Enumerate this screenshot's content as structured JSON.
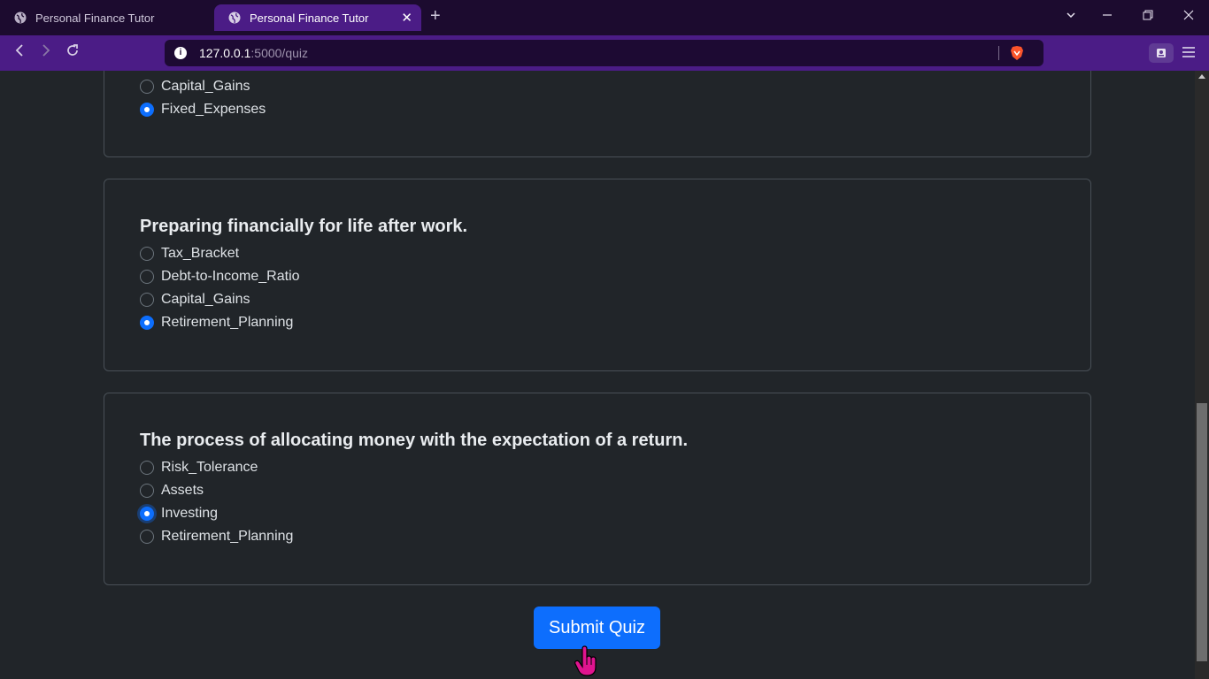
{
  "browser": {
    "tabs": [
      {
        "title": "Personal Finance Tutor",
        "active": false
      },
      {
        "title": "Personal Finance Tutor",
        "active": true
      }
    ],
    "new_tab": "+",
    "url_host": "127.0.0.1",
    "url_path": ":5000/quiz",
    "colors": {
      "titlebar": "#1c0b2f",
      "toolbar": "#4b1c86",
      "urlbar": "#1d0a33"
    }
  },
  "quiz": {
    "cards": [
      {
        "question": "",
        "options": [
          {
            "label": "Capital_Gains",
            "checked": false
          },
          {
            "label": "Fixed_Expenses",
            "checked": true
          }
        ]
      },
      {
        "question": "Preparing financially for life after work.",
        "options": [
          {
            "label": "Tax_Bracket",
            "checked": false
          },
          {
            "label": "Debt-to-Income_Ratio",
            "checked": false
          },
          {
            "label": "Capital_Gains",
            "checked": false
          },
          {
            "label": "Retirement_Planning",
            "checked": true
          }
        ]
      },
      {
        "question": "The process of allocating money with the expectation of a return.",
        "options": [
          {
            "label": "Risk_Tolerance",
            "checked": false
          },
          {
            "label": "Assets",
            "checked": false
          },
          {
            "label": "Investing",
            "checked": true
          },
          {
            "label": "Retirement_Planning",
            "checked": false
          }
        ]
      }
    ],
    "submit_label": "Submit Quiz",
    "accent_color": "#0d6efd"
  }
}
